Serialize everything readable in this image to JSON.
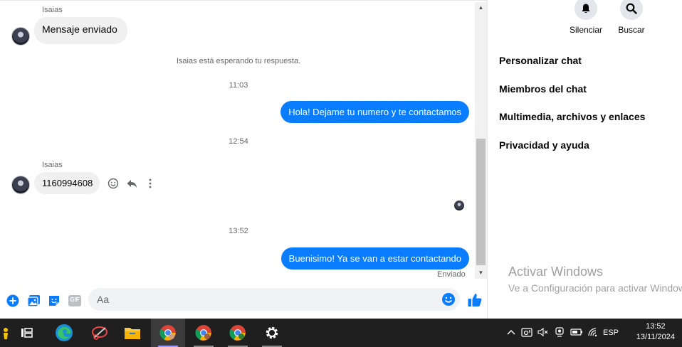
{
  "chat": {
    "messages": [
      {
        "sender": "Isaias",
        "text": "Mensaje enviado"
      },
      {
        "note": "Isaias está esperando tu respuesta."
      },
      {
        "time": "11:03"
      },
      {
        "outgoing": "Hola! Dejame tu numero y te contactamos"
      },
      {
        "time": "12:54"
      },
      {
        "sender": "Isaias",
        "text": "1160994608"
      },
      {
        "time": "13:52"
      },
      {
        "outgoing": "Buenisimo! Ya se van a estar contactando"
      }
    ],
    "sent_status": "Enviado"
  },
  "composer": {
    "placeholder": "Aa",
    "icons": [
      "plus-circle-icon",
      "image-icon",
      "sticker-icon",
      "gif-icon",
      "emoji-icon",
      "thumbs-up-icon"
    ],
    "gif_label": "GIF"
  },
  "panel": {
    "actions": [
      {
        "label": "Silenciar",
        "icon": "bell-icon"
      },
      {
        "label": "Buscar",
        "icon": "search-icon"
      }
    ],
    "items": [
      {
        "label": "Personalizar chat"
      },
      {
        "label": "Miembros del chat"
      },
      {
        "label": "Multimedia, archivos y enlaces"
      },
      {
        "label": "Privacidad y ayuda"
      }
    ]
  },
  "watermark": {
    "title": "Activar Windows",
    "subtitle": "Ve a Configuración para activar Windows."
  },
  "taskbar": {
    "language": "ESP",
    "time": "13:52",
    "date": "13/11/2024"
  },
  "colors": {
    "accent": "#0a7cff",
    "incoming_bubble": "#f0f0f0",
    "taskbar": "#1f1f1f"
  }
}
